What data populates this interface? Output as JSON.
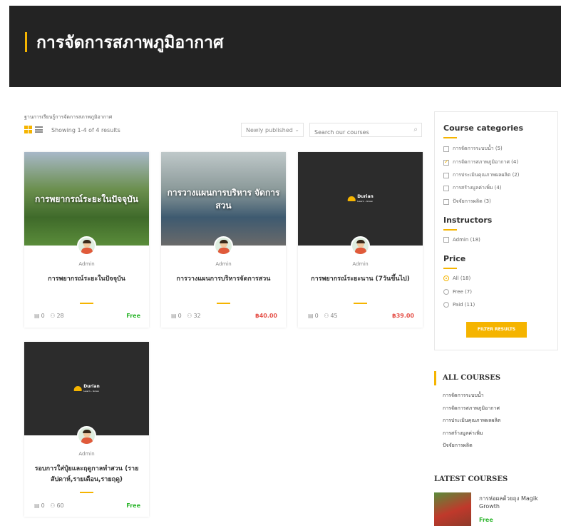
{
  "hero": {
    "title": "การจัดการสภาพภูมิอากาศ"
  },
  "breadcrumb": "ฐานการเรียนรู้การจัดการสภาพภูมิอากาศ",
  "toolbar": {
    "results": "Showing 1-4 of 4 results",
    "sort": "Newly published",
    "search_placeholder": "Search our courses"
  },
  "courses": [
    {
      "thumb_text": "การพยากรณ์ระยะในปัจจุบัน",
      "author": "Admin",
      "title": "การพยากรณ์ระยะในปัจจุบัน",
      "lessons": "0",
      "students": "28",
      "price": "Free"
    },
    {
      "thumb_text": "การวางแผนการบริหาร จัดการสวน",
      "author": "Admin",
      "title": "การวางแผนการบริหารจัดการสวน",
      "lessons": "0",
      "students": "32",
      "price": "฿40.00"
    },
    {
      "logo": "Durian",
      "logo_sub": "Learn · Grow",
      "author": "Admin",
      "title": "การพยากรณ์ระยะนาน (7วันขึ้นไป)",
      "lessons": "0",
      "students": "45",
      "price": "฿39.00"
    },
    {
      "logo": "Durian",
      "logo_sub": "Learn · Grow",
      "author": "Admin",
      "title": "รอบการใส่ปุ๋ยและฤดูกาลทำสวน (รายสัปดาห์,รายเดือน,รายฤดู)",
      "lessons": "0",
      "students": "60",
      "price": "Free"
    }
  ],
  "filters": {
    "categories_title": "Course categories",
    "categories": [
      {
        "label": "การจัดการระบบน้ำ (5)",
        "checked": false
      },
      {
        "label": "การจัดการสภาพภูมิอากาศ (4)",
        "checked": true
      },
      {
        "label": "การประเมินคุณภาพผลผลิต (2)",
        "checked": false
      },
      {
        "label": "การสร้างมูลค่าเพิ่ม (4)",
        "checked": false
      },
      {
        "label": "ปัจจัยการผลิต (3)",
        "checked": false
      }
    ],
    "instructors_title": "Instructors",
    "instructors": [
      {
        "label": "Admin (18)"
      }
    ],
    "price_title": "Price",
    "prices": [
      {
        "label": "All (18)",
        "selected": true
      },
      {
        "label": "Free (7)",
        "selected": false
      },
      {
        "label": "Paid (11)",
        "selected": false
      }
    ],
    "button": "FILTER RESULTS"
  },
  "all_courses": {
    "title": "ALL COURSES",
    "links": [
      "การจัดการระบบน้ำ",
      "การจัดการสภาพภูมิอากาศ",
      "การประเมินคุณภาพผลผลิต",
      "การสร้างมูลค่าเพิ่ม",
      "ปัจจัยการผลิต"
    ]
  },
  "latest": {
    "title": "LATEST COURSES",
    "name": "การห่อผลด้วยถุง Magik Growth",
    "price": "Free"
  },
  "colors": {
    "accent": "#f5b400",
    "hero_bg": "#232323",
    "free": "#2bb52b",
    "paid": "#e5534b"
  }
}
